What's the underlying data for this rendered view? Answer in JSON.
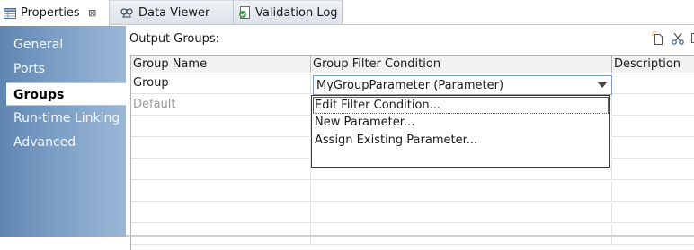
{
  "tabs": [
    {
      "label": "Properties",
      "icon": "properties-table-icon",
      "active": true,
      "close": "⊠"
    },
    {
      "label": "Data Viewer",
      "icon": "data-viewer-icon",
      "active": false
    },
    {
      "label": "Validation Log",
      "icon": "validation-log-icon",
      "active": false
    }
  ],
  "nav": {
    "items": [
      {
        "label": "General"
      },
      {
        "label": "Ports"
      },
      {
        "label": "Groups",
        "selected": true
      },
      {
        "label": "Run-time Linking"
      },
      {
        "label": "Advanced"
      }
    ]
  },
  "content": {
    "section_label": "Output Groups:",
    "toolbar": [
      "new-icon",
      "cut-icon",
      "copy-icon"
    ]
  },
  "grid": {
    "headers": [
      "Group Name",
      "Group Filter Condition",
      "Description"
    ],
    "rows": [
      {
        "name": "Group",
        "condition": "MyGroupParameter (Parameter)",
        "description": ""
      },
      {
        "name": "Default",
        "condition": "",
        "description": "",
        "disabled": true
      }
    ]
  },
  "menu": {
    "items": [
      {
        "label": "Edit Filter Condition..."
      },
      {
        "label": "New Parameter..."
      },
      {
        "label": "Assign Existing Parameter..."
      }
    ]
  },
  "colors": {
    "nav_gradient_start": "#5f86b1",
    "nav_gradient_end": "#9cb7d6",
    "selected_nav_bg": "#ffffff",
    "combo_border": "#7a9cc5"
  }
}
